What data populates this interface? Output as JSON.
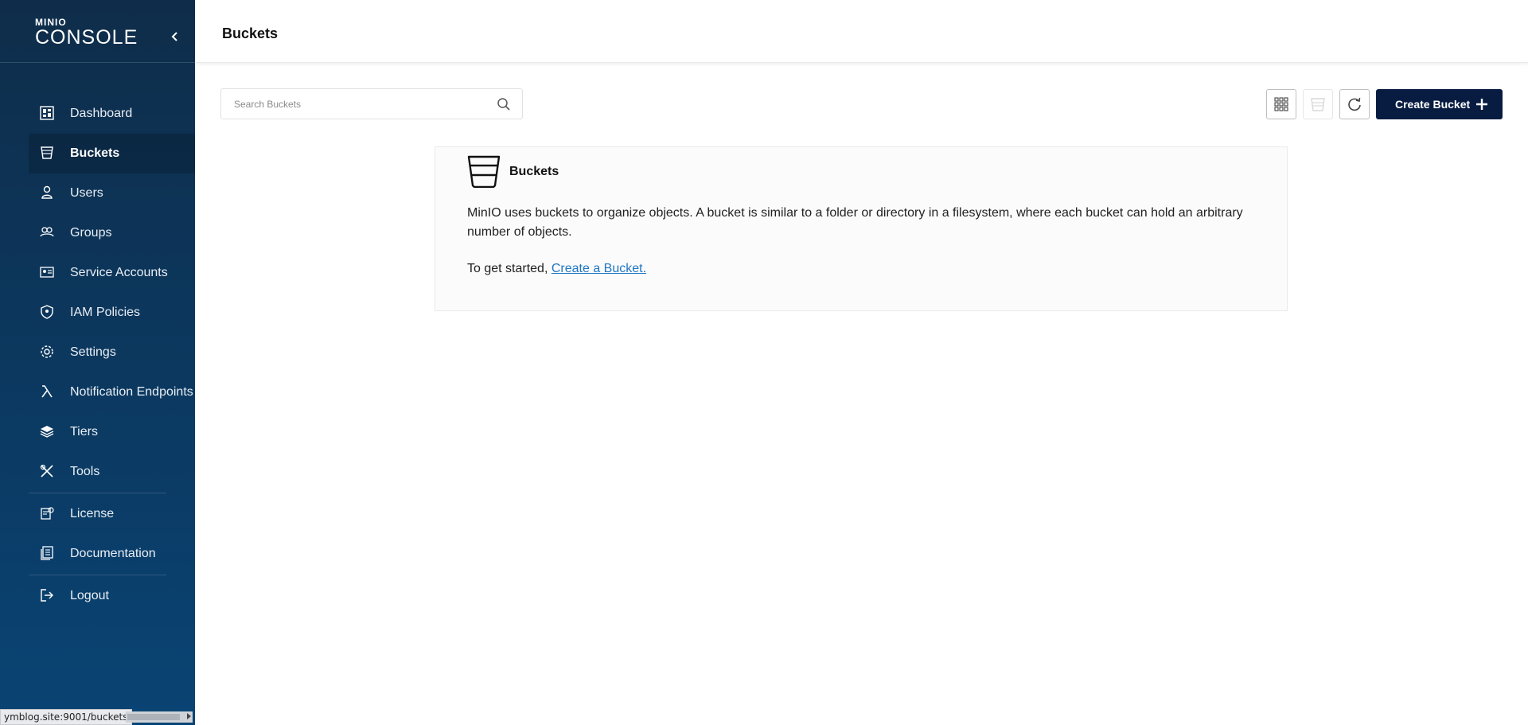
{
  "sidebar": {
    "brand_small": "MINIO",
    "brand_big": "CONSOLE",
    "items": [
      {
        "label": "Dashboard",
        "icon": "dashboard-icon"
      },
      {
        "label": "Buckets",
        "icon": "bucket-icon",
        "active": true
      },
      {
        "label": "Users",
        "icon": "user-icon"
      },
      {
        "label": "Groups",
        "icon": "groups-icon"
      },
      {
        "label": "Service Accounts",
        "icon": "service-accounts-icon"
      },
      {
        "label": "IAM Policies",
        "icon": "shield-icon"
      },
      {
        "label": "Settings",
        "icon": "gear-icon"
      },
      {
        "label": "Notification Endpoints",
        "icon": "lambda-icon"
      },
      {
        "label": "Tiers",
        "icon": "layers-icon"
      },
      {
        "label": "Tools",
        "icon": "tools-icon"
      },
      {
        "label": "License",
        "icon": "license-icon"
      },
      {
        "label": "Documentation",
        "icon": "documentation-icon"
      },
      {
        "label": "Logout",
        "icon": "logout-icon"
      }
    ]
  },
  "header": {
    "title": "Buckets"
  },
  "toolbar": {
    "search_placeholder": "Search Buckets",
    "search_value": "",
    "create_label": "Create Bucket"
  },
  "card": {
    "title": "Buckets",
    "body": "MinIO uses buckets to organize objects. A bucket is similar to a folder or directory in a filesystem, where each bucket can hold an arbitrary number of objects.",
    "start_text": "To get started, ",
    "start_link": "Create a Bucket."
  },
  "status_bar": {
    "url": "ymblog.site:9001/buckets"
  },
  "colors": {
    "sidebar_bg": "#0f2d4a",
    "primary_button": "#081c42",
    "link": "#1f76c2"
  }
}
